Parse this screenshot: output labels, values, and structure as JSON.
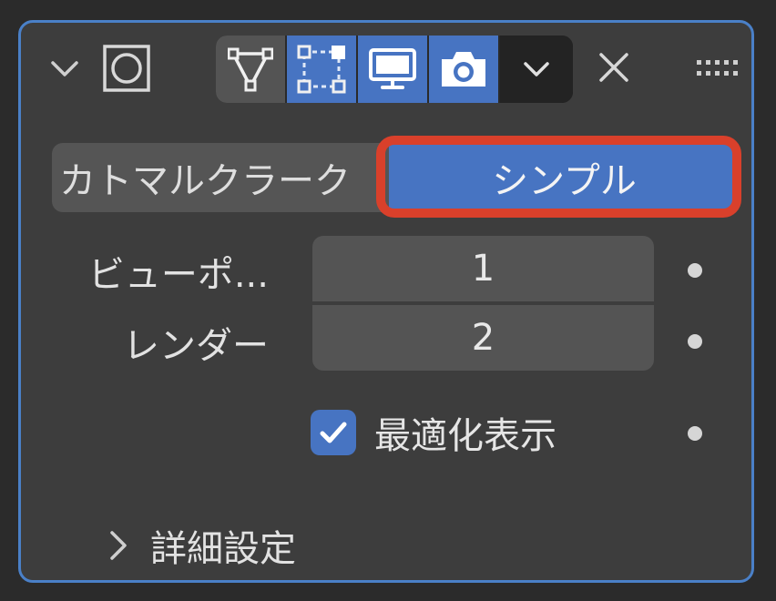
{
  "header": {
    "icons": {
      "collapse": "chevron-down-icon",
      "modifier": "subdivision-surface-icon",
      "edit_mode": "edit-mode-triangle-icon",
      "cage": "on-cage-icon",
      "viewport": "monitor-icon",
      "render": "camera-icon",
      "dropdown": "chevron-down-icon",
      "delete": "close-icon",
      "drag": "drag-handle-icon"
    },
    "mode_states": {
      "edit_mode": false,
      "on_cage": true,
      "viewport": true,
      "render": true
    }
  },
  "subdivision_type": {
    "options": [
      "カトマルクラーク",
      "シンプル"
    ],
    "selected": "シンプル"
  },
  "levels": {
    "viewport_label": "ビューポ...",
    "viewport_value": "1",
    "render_label": "レンダー",
    "render_value": "2"
  },
  "optimal_display": {
    "label": "最適化表示",
    "checked": true
  },
  "advanced": {
    "label": "詳細設定"
  },
  "colors": {
    "panel_bg": "#3d3d3d",
    "panel_border": "#4a80c8",
    "accent_blue": "#4774c2",
    "highlight_red": "#d9402b"
  }
}
